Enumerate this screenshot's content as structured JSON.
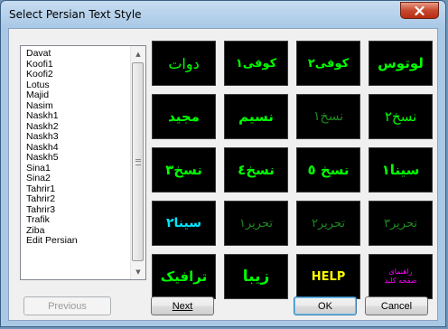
{
  "window": {
    "title": "Select Persian Text Style",
    "colors": {
      "tile_bg": "#000000",
      "green": "#00ff00",
      "cyan": "#00e5ff",
      "yellow": "#ffff00",
      "magenta": "#ff00ff",
      "dim_green": "#1e8a1e"
    }
  },
  "list": {
    "items": [
      "Davat",
      "Koofi1",
      "Koofi2",
      "Lotus",
      "Majid",
      "Nasim",
      "Naskh1",
      "Naskh2",
      "Naskh3",
      "Naskh4",
      "Naskh5",
      "Sina1",
      "Sina2",
      "Tahrir1",
      "Tahrir2",
      "Tahrir3",
      "Trafik",
      "Ziba",
      "Edit Persian"
    ]
  },
  "tiles": [
    {
      "text": "دوات",
      "color": "#00ff00",
      "size": 16,
      "weight": "normal"
    },
    {
      "text": "کوفی١",
      "color": "#00ff00",
      "size": 13,
      "weight": "bold"
    },
    {
      "text": "کوفی٢",
      "color": "#00ff00",
      "size": 13,
      "weight": "bold"
    },
    {
      "text": "لوتوس",
      "color": "#00ff00",
      "size": 15,
      "weight": "bold"
    },
    {
      "text": "مجید",
      "color": "#00ff00",
      "size": 15,
      "weight": "bold"
    },
    {
      "text": "نسیم",
      "color": "#00ff00",
      "size": 15,
      "weight": "bold"
    },
    {
      "text": "نسخ١",
      "color": "#1e8a1e",
      "size": 14,
      "weight": "normal"
    },
    {
      "text": "نسخ٢",
      "color": "#00ff00",
      "size": 15,
      "weight": "normal"
    },
    {
      "text": "نسخ٣",
      "color": "#00ff00",
      "size": 15,
      "weight": "bold"
    },
    {
      "text": "نسخ٤",
      "color": "#00ff00",
      "size": 15,
      "weight": "bold"
    },
    {
      "text": "نسخ ٥",
      "color": "#00ff00",
      "size": 15,
      "weight": "bold"
    },
    {
      "text": "سینا١",
      "color": "#00ff00",
      "size": 15,
      "weight": "bold"
    },
    {
      "text": "سینا٢",
      "color": "#00e5ff",
      "size": 14,
      "weight": "bold"
    },
    {
      "text": "تحریر١",
      "color": "#1e8a1e",
      "size": 13,
      "weight": "normal"
    },
    {
      "text": "تحریر٢",
      "color": "#1e8a1e",
      "size": 13,
      "weight": "normal"
    },
    {
      "text": "تحریر٣",
      "color": "#1e8a1e",
      "size": 13,
      "weight": "normal"
    },
    {
      "text": "ترافیک",
      "color": "#00ff00",
      "size": 15,
      "weight": "bold"
    },
    {
      "text": "زیبا",
      "color": "#00ff00",
      "size": 17,
      "weight": "bold"
    },
    {
      "text": "HELP",
      "color": "#ffff00",
      "size": 13,
      "weight": "bold"
    },
    {
      "text": "راهنمای\nصفحه کلید",
      "color": "#ff00ff",
      "size": 8,
      "weight": "normal"
    }
  ],
  "buttons": {
    "previous": "Previous",
    "next": "Next",
    "ok": "OK",
    "cancel": "Cancel"
  },
  "icons": {
    "close": "close-icon",
    "scroll_up": "arrow-up-icon",
    "scroll_down": "arrow-down-icon"
  }
}
